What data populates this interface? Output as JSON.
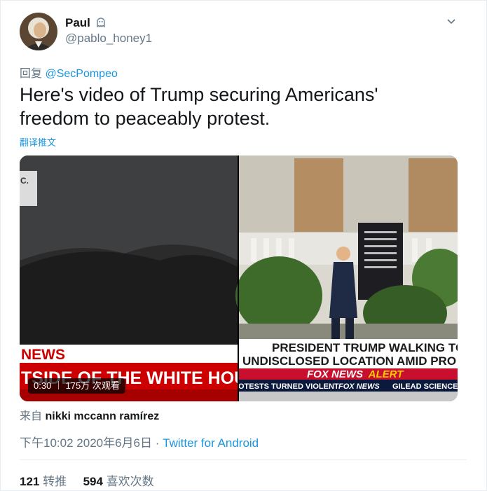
{
  "author": {
    "display_name": "Paul",
    "status_icon": "ghost-icon",
    "handle": "@pablo_honey1"
  },
  "reply": {
    "prefix": "回复",
    "mention": "@SecPompeo"
  },
  "tweet_text": "Here's video of Trump securing Americans' freedom to peaceably protest.",
  "translate_label": "翻译推文",
  "video": {
    "left_chyron_top": "NEWS",
    "left_chyron_bottom": "TSIDE OF THE WHITE HOUSE",
    "left_edge_text": "C.",
    "right_chyron_line1": "PRESIDENT TRUMP WALKING TO",
    "right_chyron_line2": "UNDISCLOSED LOCATION AMID PRO",
    "alert_brand": "FOX NEWS",
    "alert_word": "ALERT",
    "ticker_left": "OTESTS TURNED VIOLENT",
    "ticker_brand": "FOX NEWS",
    "ticker_right": "GILEAD SCIENCES S",
    "duration": "0:30",
    "views": "175万 次观看"
  },
  "source": {
    "prefix": "来自",
    "name": "nikki mccann ramírez"
  },
  "meta": {
    "time": "下午10:02",
    "date": "2020年6月6日",
    "separator": " · ",
    "client": "Twitter for Android"
  },
  "stats": {
    "retweets": "121",
    "retweets_label": "转推",
    "likes": "594",
    "likes_label": "喜欢次数"
  },
  "colors": {
    "link": "#1b95e0",
    "muted": "#657786",
    "text": "#14171a",
    "chyron_red": "#cc0000"
  }
}
